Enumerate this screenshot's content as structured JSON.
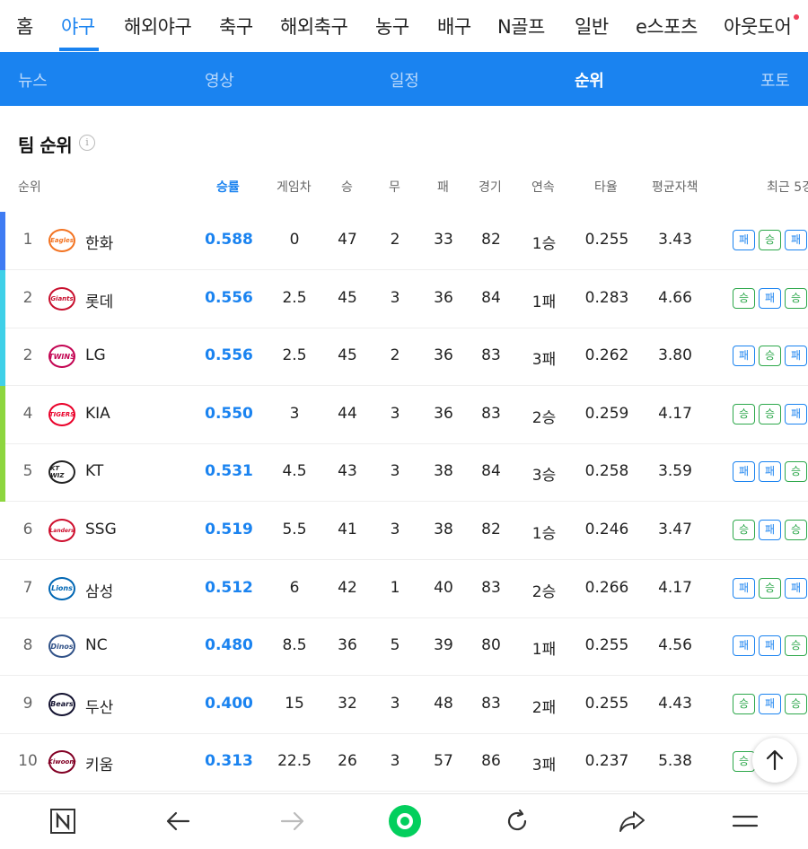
{
  "top_nav": {
    "items": [
      "홈",
      "야구",
      "해외야구",
      "축구",
      "해외축구",
      "농구",
      "배구",
      "N골프",
      "일반",
      "e스포츠",
      "아웃도어"
    ],
    "active": "야구"
  },
  "sub_nav": {
    "items": [
      "뉴스",
      "영상",
      "일정",
      "순위",
      "포토"
    ],
    "active": "순위"
  },
  "section_title": "팀 순위",
  "info_icon": "i",
  "columns": [
    "순위",
    "승률",
    "게임차",
    "승",
    "무",
    "패",
    "경기",
    "연속",
    "타율",
    "평균자책",
    "최근 5경"
  ],
  "rows": [
    {
      "rank": "1",
      "team": "한화",
      "logo": "Eagles",
      "pct": "0.588",
      "gb": "0",
      "w": "47",
      "d": "2",
      "l": "33",
      "g": "82",
      "streak": "1승",
      "avg": "0.255",
      "era": "3.43",
      "recent": [
        "패",
        "승",
        "패"
      ],
      "bar": "#3f7cf3",
      "logo_color": "#f37321"
    },
    {
      "rank": "2",
      "team": "롯데",
      "logo": "Giants",
      "pct": "0.556",
      "gb": "2.5",
      "w": "45",
      "d": "3",
      "l": "36",
      "g": "84",
      "streak": "1패",
      "avg": "0.283",
      "era": "4.66",
      "recent": [
        "승",
        "패",
        "승"
      ],
      "bar": "#3fd0e8",
      "logo_color": "#c8102e"
    },
    {
      "rank": "2",
      "team": "LG",
      "logo": "TWINS",
      "pct": "0.556",
      "gb": "2.5",
      "w": "45",
      "d": "2",
      "l": "36",
      "g": "83",
      "streak": "3패",
      "avg": "0.262",
      "era": "3.80",
      "recent": [
        "패",
        "승",
        "패"
      ],
      "bar": "#3fd0e8",
      "logo_color": "#c30452"
    },
    {
      "rank": "4",
      "team": "KIA",
      "logo": "TIGERS",
      "pct": "0.550",
      "gb": "3",
      "w": "44",
      "d": "3",
      "l": "36",
      "g": "83",
      "streak": "2승",
      "avg": "0.259",
      "era": "4.17",
      "recent": [
        "승",
        "승",
        "패"
      ],
      "bar": "#8dd63f",
      "logo_color": "#ea0029"
    },
    {
      "rank": "5",
      "team": "KT",
      "logo": "KT WIZ",
      "pct": "0.531",
      "gb": "4.5",
      "w": "43",
      "d": "3",
      "l": "38",
      "g": "84",
      "streak": "3승",
      "avg": "0.258",
      "era": "3.59",
      "recent": [
        "패",
        "패",
        "승"
      ],
      "bar": "#8dd63f",
      "logo_color": "#222222"
    },
    {
      "rank": "6",
      "team": "SSG",
      "logo": "Landers",
      "pct": "0.519",
      "gb": "5.5",
      "w": "41",
      "d": "3",
      "l": "38",
      "g": "82",
      "streak": "1승",
      "avg": "0.246",
      "era": "3.47",
      "recent": [
        "승",
        "패",
        "승"
      ],
      "bar": "",
      "logo_color": "#ce0e2d"
    },
    {
      "rank": "7",
      "team": "삼성",
      "logo": "Lions",
      "pct": "0.512",
      "gb": "6",
      "w": "42",
      "d": "1",
      "l": "40",
      "g": "83",
      "streak": "2승",
      "avg": "0.266",
      "era": "4.17",
      "recent": [
        "패",
        "승",
        "패"
      ],
      "bar": "",
      "logo_color": "#0066b3"
    },
    {
      "rank": "8",
      "team": "NC",
      "logo": "Dinos",
      "pct": "0.480",
      "gb": "8.5",
      "w": "36",
      "d": "5",
      "l": "39",
      "g": "80",
      "streak": "1패",
      "avg": "0.255",
      "era": "4.56",
      "recent": [
        "패",
        "패",
        "승"
      ],
      "bar": "",
      "logo_color": "#315288"
    },
    {
      "rank": "9",
      "team": "두산",
      "logo": "Bears",
      "pct": "0.400",
      "gb": "15",
      "w": "32",
      "d": "3",
      "l": "48",
      "g": "83",
      "streak": "2패",
      "avg": "0.255",
      "era": "4.43",
      "recent": [
        "승",
        "패",
        "승"
      ],
      "bar": "",
      "logo_color": "#131230"
    },
    {
      "rank": "10",
      "team": "키움",
      "logo": "Kiwoom",
      "pct": "0.313",
      "gb": "22.5",
      "w": "26",
      "d": "3",
      "l": "57",
      "g": "86",
      "streak": "3패",
      "avg": "0.237",
      "era": "5.38",
      "recent": [
        "승",
        "",
        "패"
      ],
      "bar": "",
      "logo_color": "#820024"
    }
  ],
  "colors": {
    "accent": "#1a83f0",
    "win": "#2da84b",
    "loss": "#1a83f0"
  },
  "icons": {
    "scroll_top": "arrow-up-icon",
    "bottom": [
      "naver-n-icon",
      "back-arrow-icon",
      "forward-arrow-icon",
      "green-dot-icon",
      "refresh-icon",
      "share-icon",
      "menu-icon"
    ]
  }
}
